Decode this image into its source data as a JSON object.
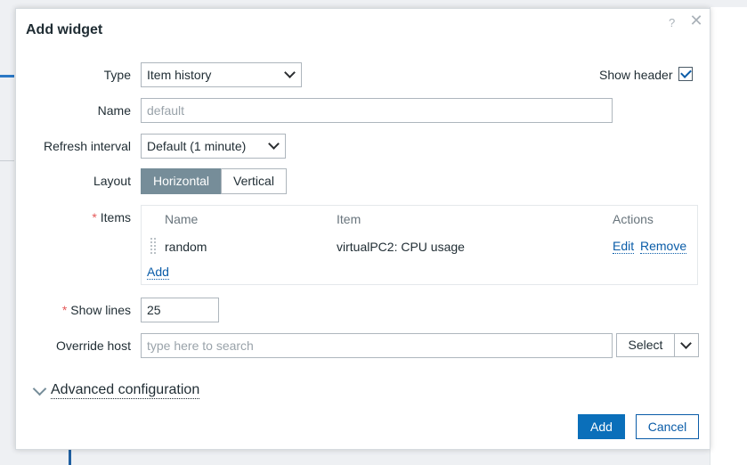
{
  "dialog": {
    "title": "Add widget",
    "help_glyph": "?",
    "close_glyph": "✕"
  },
  "form": {
    "type": {
      "label": "Type",
      "value": "Item history"
    },
    "show_header": {
      "label": "Show header",
      "checked": true
    },
    "name": {
      "label": "Name",
      "placeholder": "default"
    },
    "refresh_interval": {
      "label": "Refresh interval",
      "value": "Default (1 minute)"
    },
    "layout": {
      "label": "Layout",
      "options": [
        "Horizontal",
        "Vertical"
      ],
      "selected": "Horizontal"
    },
    "items": {
      "label": "Items",
      "columns": [
        "Name",
        "Item",
        "Actions"
      ],
      "rows": [
        {
          "name": "random",
          "item": "virtualPC2: CPU usage",
          "edit": "Edit",
          "remove": "Remove"
        }
      ],
      "add_label": "Add"
    },
    "show_lines": {
      "label": "Show lines",
      "value": "25"
    },
    "override_host": {
      "label": "Override host",
      "placeholder": "type here to search",
      "select_label": "Select"
    },
    "advanced": {
      "label": "Advanced configuration"
    }
  },
  "footer": {
    "add_label": "Add",
    "cancel_label": "Cancel"
  },
  "colors": {
    "primary": "#0a6fba",
    "link": "#0a5ca8",
    "segment_active": "#768d99",
    "required": "#e45959"
  }
}
